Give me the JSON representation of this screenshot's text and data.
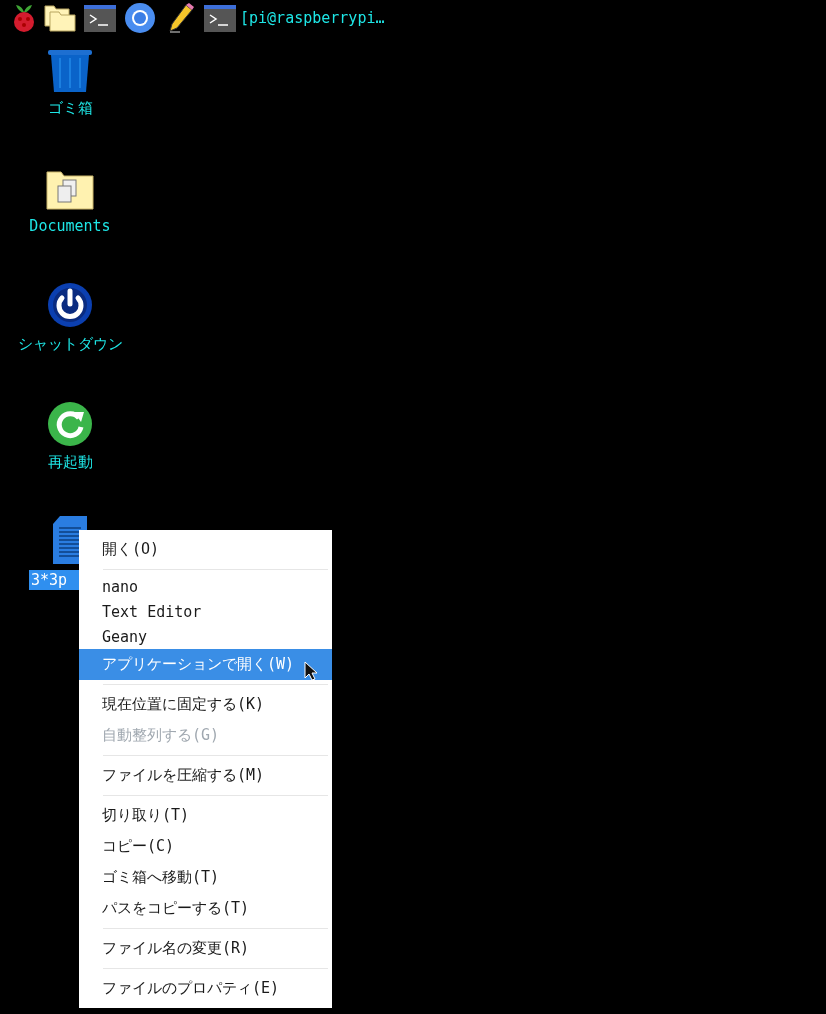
{
  "taskbar": {
    "window_button": "[pi@raspberrypi…"
  },
  "desktop_icons": [
    {
      "kind": "trash",
      "label": "ゴミ箱",
      "selected": false
    },
    {
      "kind": "folder",
      "label": "Documents",
      "selected": false
    },
    {
      "kind": "power",
      "label": "シャットダウン",
      "selected": false
    },
    {
      "kind": "restart",
      "label": "再起動",
      "selected": false
    },
    {
      "kind": "file",
      "label": "3*3p",
      "selected": true
    }
  ],
  "context_menu": {
    "items": [
      {
        "kind": "item",
        "label": "開く(O)",
        "disabled": false,
        "selected": false
      },
      {
        "kind": "separator"
      },
      {
        "kind": "app",
        "label": "nano",
        "disabled": false,
        "selected": false
      },
      {
        "kind": "app",
        "label": "Text Editor",
        "disabled": false,
        "selected": false
      },
      {
        "kind": "app",
        "label": "Geany",
        "disabled": false,
        "selected": false
      },
      {
        "kind": "item",
        "label": "アプリケーションで開く(W)",
        "disabled": false,
        "selected": true
      },
      {
        "kind": "separator"
      },
      {
        "kind": "item",
        "label": "現在位置に固定する(K)",
        "disabled": false,
        "selected": false
      },
      {
        "kind": "item",
        "label": "自動整列する(G)",
        "disabled": true,
        "selected": false
      },
      {
        "kind": "separator"
      },
      {
        "kind": "item",
        "label": "ファイルを圧縮する(M)",
        "disabled": false,
        "selected": false
      },
      {
        "kind": "separator"
      },
      {
        "kind": "item",
        "label": "切り取り(T)",
        "disabled": false,
        "selected": false
      },
      {
        "kind": "item",
        "label": "コピー(C)",
        "disabled": false,
        "selected": false
      },
      {
        "kind": "item",
        "label": "ゴミ箱へ移動(T)",
        "disabled": false,
        "selected": false
      },
      {
        "kind": "item",
        "label": "パスをコピーする(T)",
        "disabled": false,
        "selected": false
      },
      {
        "kind": "separator"
      },
      {
        "kind": "item",
        "label": "ファイル名の変更(R)",
        "disabled": false,
        "selected": false
      },
      {
        "kind": "separator"
      },
      {
        "kind": "item",
        "label": "ファイルのプロパティ(E)",
        "disabled": false,
        "selected": false
      }
    ]
  }
}
